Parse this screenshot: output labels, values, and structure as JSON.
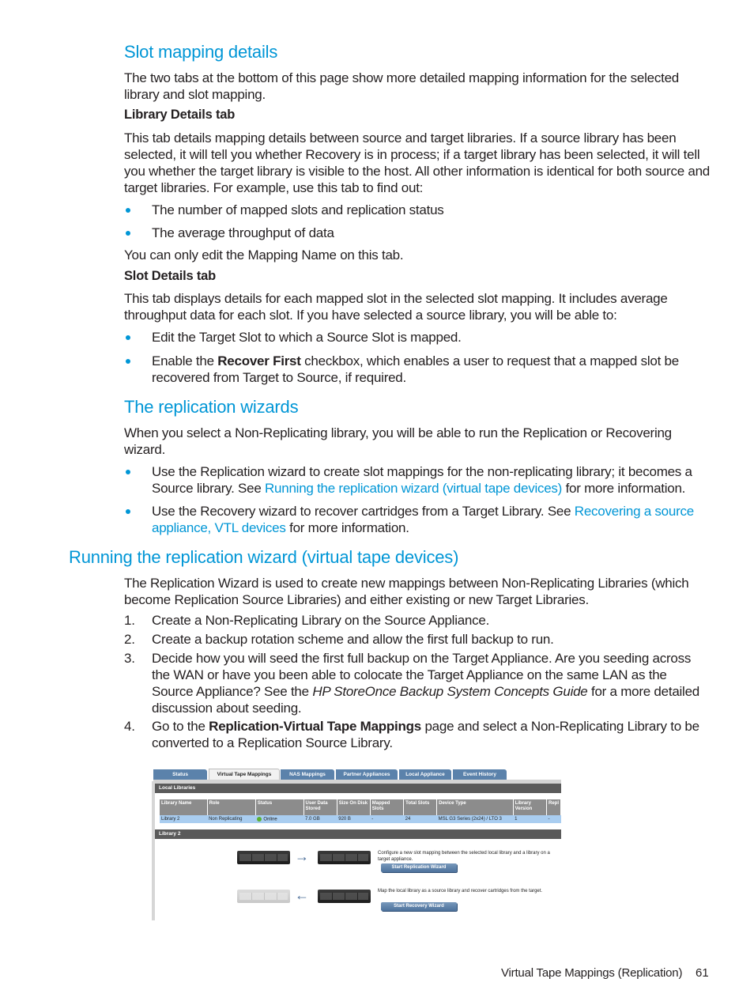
{
  "section1": {
    "heading": "Slot mapping details",
    "intro": "The two tabs at the bottom of this page show more detailed mapping information for the selected library and slot mapping.",
    "library_details": {
      "heading": "Library Details tab",
      "body": "This tab details mapping details between source and target libraries. If a source library has been selected, it will tell you whether Recovery is in process; if a target library has been selected, it will tell you whether the target library is visible to the host. All other information is identical for both source and target libraries. For example, use this tab to find out:",
      "bullets": [
        "The number of mapped slots and replication status",
        "The average throughput of data"
      ],
      "note": "You can only edit the Mapping Name on this tab."
    },
    "slot_details": {
      "heading": "Slot Details tab",
      "body": "This tab displays details for each mapped slot in the selected slot mapping. It includes average throughput data for each slot. If you have selected a source library, you will be able to:",
      "bullet1": "Edit the Target Slot to which a Source Slot is mapped.",
      "bullet2_pre": "Enable the ",
      "bullet2_bold": "Recover First",
      "bullet2_post": " checkbox, which enables a user to request that a mapped slot be recovered from Target to Source, if required."
    }
  },
  "section2": {
    "heading": "The replication wizards",
    "intro": "When you select a Non-Replicating library, you will be able to run the Replication or Recovering wizard.",
    "bullet1_pre": "Use the Replication wizard to create slot mappings for the non-replicating library; it becomes a Source library. See ",
    "bullet1_link": "Running the replication wizard (virtual tape devices)",
    "bullet1_post": " for more information.",
    "bullet2_pre": "Use the Recovery wizard to recover cartridges from a Target Library. See ",
    "bullet2_link": "Recovering a source appliance, VTL devices",
    "bullet2_post": " for more information."
  },
  "section3": {
    "heading": "Running the replication wizard (virtual tape devices)",
    "intro": "The Replication Wizard is used to create new mappings between Non-Replicating Libraries (which become Replication Source Libraries) and either existing or new Target Libraries.",
    "steps": [
      {
        "num": "1.",
        "text": "Create a Non-Replicating Library on the Source Appliance."
      },
      {
        "num": "2.",
        "text": "Create a backup rotation scheme and allow the first full backup to run."
      }
    ],
    "step3": {
      "num": "3.",
      "pre": "Decide how you will seed the first full backup on the Target Appliance. Are you seeding across the WAN or have you been able to colocate the Target Appliance on the same LAN as the Source Appliance? See the ",
      "italic": "HP StoreOnce Backup System Concepts Guide",
      "post": " for a more detailed discussion about seeding."
    },
    "step4": {
      "num": "4.",
      "pre": "Go to the ",
      "bold": "Replication-Virtual Tape Mappings",
      "post": " page and select a Non-Replicating Library to be converted to a Replication Source Library."
    }
  },
  "screenshot": {
    "tabs": [
      "Status",
      "Virtual Tape Mappings",
      "NAS Mappings",
      "Partner Appliances",
      "Local Appliance",
      "Event History"
    ],
    "active_tab": "Virtual Tape Mappings",
    "local_libraries_title": "Local Libraries",
    "columns": [
      "Library Name",
      "Role",
      "Status",
      "User Data Stored",
      "Size On Disk",
      "Mapped Slots",
      "Total Slots",
      "Device Type",
      "Library Version",
      "Repl"
    ],
    "row": [
      "Library 2",
      "Non Replicating",
      "Online",
      "7.0 GB",
      "920 B",
      "-",
      "24",
      "MSL G3 Series (2x24) / LTO 3",
      "1",
      "-"
    ],
    "library_title": "Library 2",
    "replication_desc": "Configure a new slot mapping between the selected local library and a library on a target appliance.",
    "replication_button": "Start Replication Wizard",
    "recovery_desc": "Map the local library as a source library and recover cartridges from the target.",
    "recovery_button": "Start Recovery Wizard"
  },
  "footer": {
    "title": "Virtual Tape Mappings (Replication)",
    "page_number": "61"
  },
  "colors": {
    "accent": "#0096d6",
    "text": "#231f20"
  }
}
